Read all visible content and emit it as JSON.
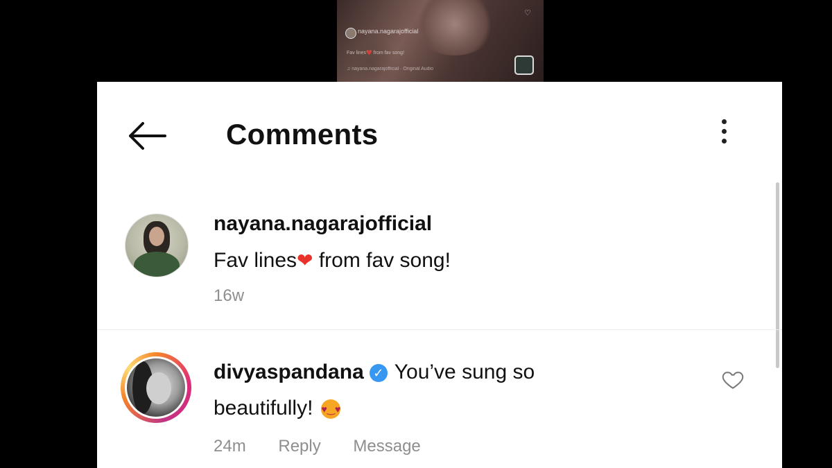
{
  "video_thumbnail": {
    "username": "nayana.nagarajofficial",
    "caption": "Fav lines❤️ from fav song!",
    "audio": "♫ nayana.nagarajofficial · Original Audio"
  },
  "header": {
    "title": "Comments",
    "back_icon": "arrow-left-icon",
    "more_icon": "vertical-ellipsis-icon"
  },
  "comments": [
    {
      "username": "nayana.nagarajofficial",
      "text": "Fav lines",
      "emoji": "❤",
      "text_after": " from fav song!",
      "time": "16w"
    },
    {
      "username": "divyaspandana",
      "verified": true,
      "text_line1": "You’ve sung so",
      "text_line2": "beautifully!",
      "emoji": "😻",
      "time": "24m",
      "reply_label": "Reply",
      "message_label": "Message",
      "like_icon": "heart-outline-icon"
    }
  ],
  "colors": {
    "background": "#000000",
    "panel": "#ffffff",
    "verified_badge": "#3897f0",
    "heart": "#e8332a",
    "meta_text": "#8e8e8e"
  }
}
